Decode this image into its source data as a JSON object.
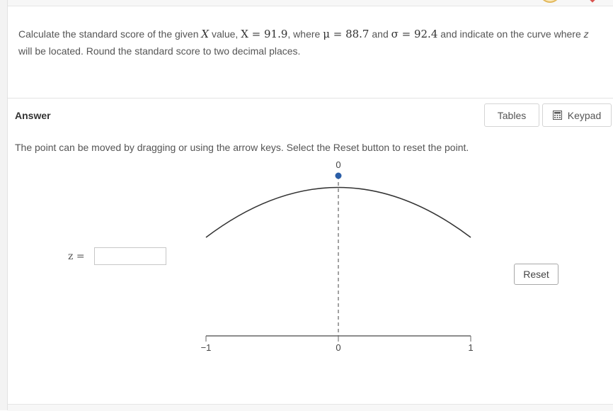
{
  "question": {
    "part1": "Calculate the standard score of the given ",
    "x_symbol": "X",
    "part2": " value, ",
    "x_eq": "X = 91.9",
    "part3": ", where ",
    "mu_eq": "μ = 88.7",
    "part4": " and ",
    "sigma_eq": "σ = 92.4",
    "part5": " and indicate on the curve where ",
    "z_symbol": "z",
    "part6": " will be located.  Round the standard score to two decimal places."
  },
  "answer": {
    "title": "Answer",
    "tables_label": "Tables",
    "keypad_label": "Keypad",
    "instruction": "The point can be moved by dragging or using the arrow keys. Select the Reset button to reset the point."
  },
  "graph": {
    "point_value_label": "0",
    "point_z": 0,
    "axis_ticks": [
      "−1",
      "0",
      "1"
    ],
    "curve_color": "#333333",
    "point_color": "#2b5ea7"
  },
  "z_field": {
    "label": "z =",
    "value": ""
  },
  "reset_label": "Reset"
}
